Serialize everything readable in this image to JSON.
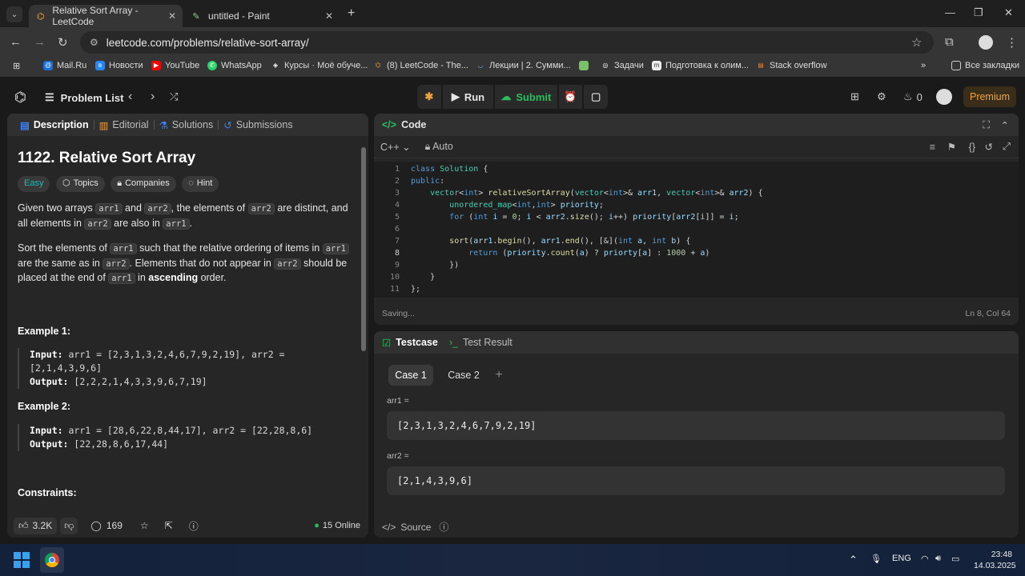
{
  "browser": {
    "tabs": [
      {
        "title": "Relative Sort Array - LeetCode"
      },
      {
        "title": "untitled - Paint"
      }
    ],
    "url": "leetcode.com/problems/relative-sort-array/",
    "bookmarks": [
      "Mail.Ru",
      "Новости",
      "YouTube",
      "WhatsApp",
      "Курсы · Моё обуче...",
      "(8) LeetCode - The...",
      "Лекции | 2. Сумми...",
      "",
      "Задачи",
      "Подготовка к олим...",
      "Stack overflow"
    ],
    "all_bookmarks": "Все закладки"
  },
  "header": {
    "problem_list": "Problem List",
    "run": "Run",
    "submit": "Submit",
    "streak": "0",
    "premium": "Premium"
  },
  "description": {
    "tabs": [
      "Description",
      "Editorial",
      "Solutions",
      "Submissions"
    ],
    "title": "1122. Relative Sort Array",
    "difficulty": "Easy",
    "pills": [
      "Topics",
      "Companies",
      "Hint"
    ],
    "p1": {
      "a": "Given two arrays ",
      "c1": "arr1",
      "b": " and ",
      "c2": "arr2",
      "c": ", the elements of ",
      "c3": "arr2",
      "d": " are distinct, and all elements in ",
      "c4": "arr2",
      "e": " are also in ",
      "c5": "arr1",
      "f": "."
    },
    "p2": {
      "a": "Sort the elements of ",
      "c1": "arr1",
      "b": " such that the relative ordering of items in ",
      "c2": "arr1",
      "c": " are the same as in ",
      "c3": "arr2",
      "d": ". Elements that do not appear in ",
      "c4": "arr2",
      "e": " should be placed at the end of ",
      "c5": "arr1",
      "f": " in ",
      "strong": "ascending",
      "g": " order."
    },
    "ex1_title": "Example 1:",
    "ex1_input_label": "Input:",
    "ex1_input": " arr1 = [2,3,1,3,2,4,6,7,9,2,19], arr2 = [2,1,4,3,9,6]",
    "ex1_output_label": "Output:",
    "ex1_output": " [2,2,2,1,4,3,3,9,6,7,19]",
    "ex2_title": "Example 2:",
    "ex2_input_label": "Input:",
    "ex2_input": " arr1 = [28,6,22,8,44,17], arr2 = [22,28,8,6]",
    "ex2_output_label": "Output:",
    "ex2_output": " [22,28,8,6,17,44]",
    "constraints_title": "Constraints:",
    "likes": "3.2K",
    "comments": "169",
    "online": "15 Online"
  },
  "code": {
    "title": "Code",
    "language": "C++",
    "mode": "Auto",
    "status": "Saving...",
    "cursor": "Ln 8, Col 64",
    "lines": [
      "1",
      "2",
      "3",
      "4",
      "5",
      "6",
      "7",
      "8",
      "9",
      "10",
      "11"
    ]
  },
  "test": {
    "tab1": "Testcase",
    "tab2": "Test Result",
    "case1": "Case 1",
    "case2": "Case 2",
    "var1": "arr1 =",
    "val1": "[2,3,1,3,2,4,6,7,9,2,19]",
    "var2": "arr2 =",
    "val2": "[2,1,4,3,9,6]",
    "source": "Source"
  },
  "taskbar": {
    "lang": "ENG",
    "time": "23:48",
    "date": "14.03.2025"
  }
}
